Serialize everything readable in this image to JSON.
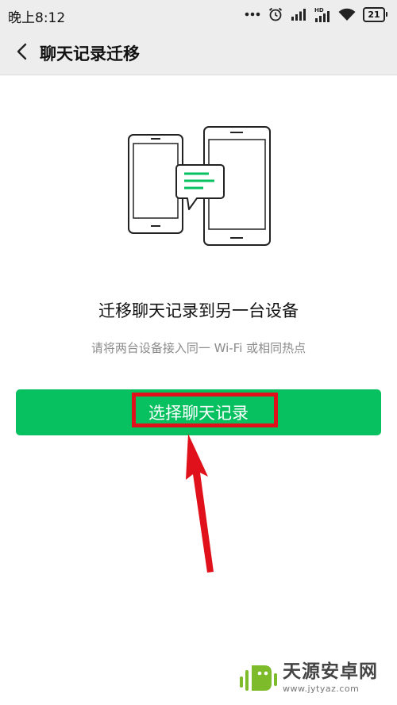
{
  "status_bar": {
    "time": "晚上8:12",
    "network_label": "HD",
    "battery": "21",
    "icons": [
      "more-dots-icon",
      "alarm-icon",
      "signal-icon",
      "signal-hd-icon",
      "wifi-icon",
      "battery-icon"
    ]
  },
  "nav": {
    "title": "聊天记录迁移",
    "back_icon": "back-chevron-icon"
  },
  "main": {
    "heading": "迁移聊天记录到另一台设备",
    "subtitle": "请将两台设备接入同一 Wi-Fi 或相同热点",
    "illustration_icon": "phone-transfer-illustration"
  },
  "button": {
    "label": "选择聊天记录"
  },
  "annotation": {
    "highlight_color": "#e0111a",
    "arrow_icon": "red-arrow-icon"
  },
  "watermark": {
    "name": "天源安卓网",
    "url": "www.jytyaz.com"
  },
  "colors": {
    "accent": "#07c160",
    "nav_bg": "#ededed",
    "annotation": "#e0111a"
  }
}
